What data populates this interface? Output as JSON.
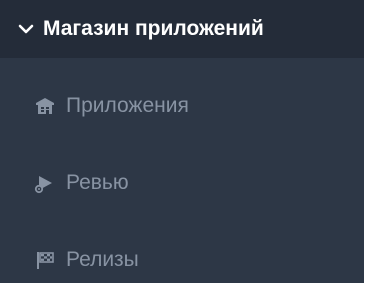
{
  "sidebar": {
    "section": {
      "title": "Магазин приложений",
      "icon": "chevron-down-icon",
      "expanded": true
    },
    "items": [
      {
        "label": "Приложения",
        "icon": "store-icon"
      },
      {
        "label": "Ревью",
        "icon": "review-icon"
      },
      {
        "label": "Релизы",
        "icon": "flag-icon"
      }
    ],
    "colors": {
      "header_bg": "#242c39",
      "panel_bg": "#2d3746",
      "header_text": "#ffffff",
      "item_text": "#8893a3"
    }
  }
}
